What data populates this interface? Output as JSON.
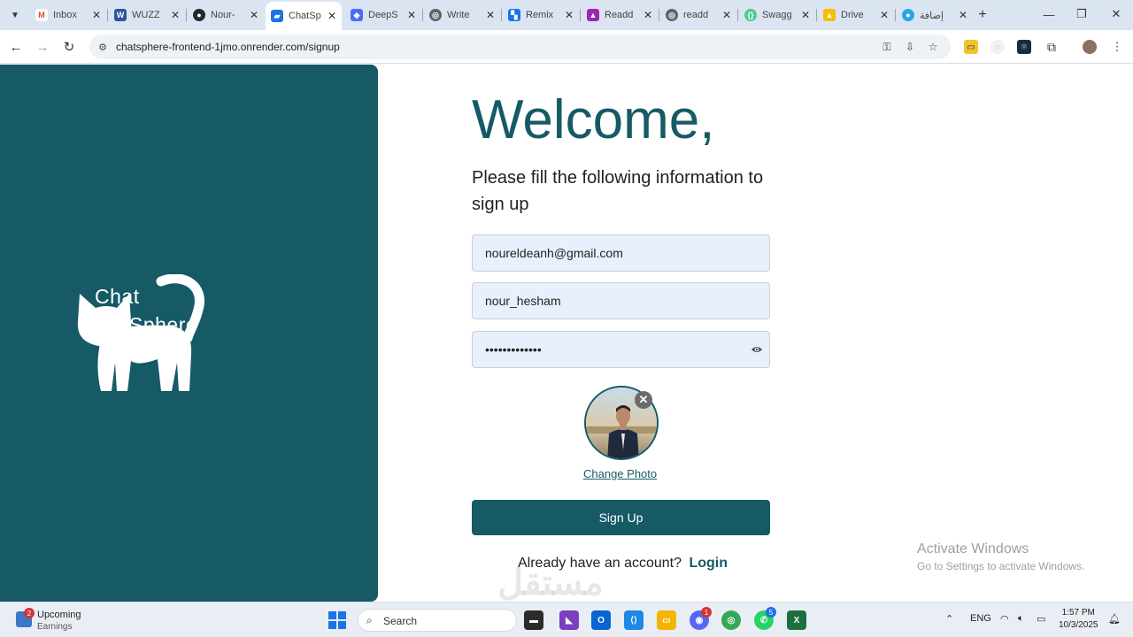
{
  "browser": {
    "tabs": [
      {
        "title": "Inbox",
        "icon": "gmail-icon",
        "color": "#ea4335"
      },
      {
        "title": "WUZZ",
        "icon": "word-icon",
        "color": "#2b579a"
      },
      {
        "title": "Nour-",
        "icon": "github-icon",
        "color": "#24292f"
      },
      {
        "title": "ChatSp",
        "icon": "chat-icon",
        "color": "#1a73e8"
      },
      {
        "title": "DeepS",
        "icon": "deepseek-icon",
        "color": "#4d6bfe"
      },
      {
        "title": "Write",
        "icon": "globe-icon",
        "color": "#5f6368"
      },
      {
        "title": "Remix",
        "icon": "remix-icon",
        "color": "#1a73e8"
      },
      {
        "title": "Readd",
        "icon": "readdy-icon",
        "color": "#9c27b0"
      },
      {
        "title": "readd",
        "icon": "globe-icon",
        "color": "#5f6368"
      },
      {
        "title": "Swagg",
        "icon": "swagger-icon",
        "color": "#49cc90"
      },
      {
        "title": "Drive",
        "icon": "drive-icon",
        "color": "#fbbc04"
      },
      {
        "title": "إضافة",
        "icon": "circle-icon",
        "color": "#29a8e0"
      }
    ],
    "url": "chatsphere-frontend-1jmo.onrender.com/signup"
  },
  "brand": {
    "line1": "Chat",
    "line2": "Sphere"
  },
  "form": {
    "welcome": "Welcome,",
    "subtitle": "Please fill the following information to sign up",
    "email_value": "noureldeanh@gmail.com",
    "username_value": "nour_hesham",
    "password_value": "•••••••••••••",
    "change_photo": "Change Photo",
    "signup_label": "Sign Up",
    "already_text": "Already have an account?",
    "login_label": "Login"
  },
  "overlay": {
    "activate_title": "Activate Windows",
    "activate_sub": "Go to Settings to activate Windows.",
    "watermark": "مستقل"
  },
  "taskbar": {
    "widget_title": "Upcoming",
    "widget_sub": "Earnings",
    "widget_badge": "2",
    "search_label": "Search",
    "discord_badge": "1",
    "whatsapp_badge": "5",
    "lang": "ENG",
    "time": "1:57 PM",
    "date": "10/3/2025"
  },
  "colors": {
    "brand": "#155a65",
    "field_bg": "#e8f0fe"
  }
}
